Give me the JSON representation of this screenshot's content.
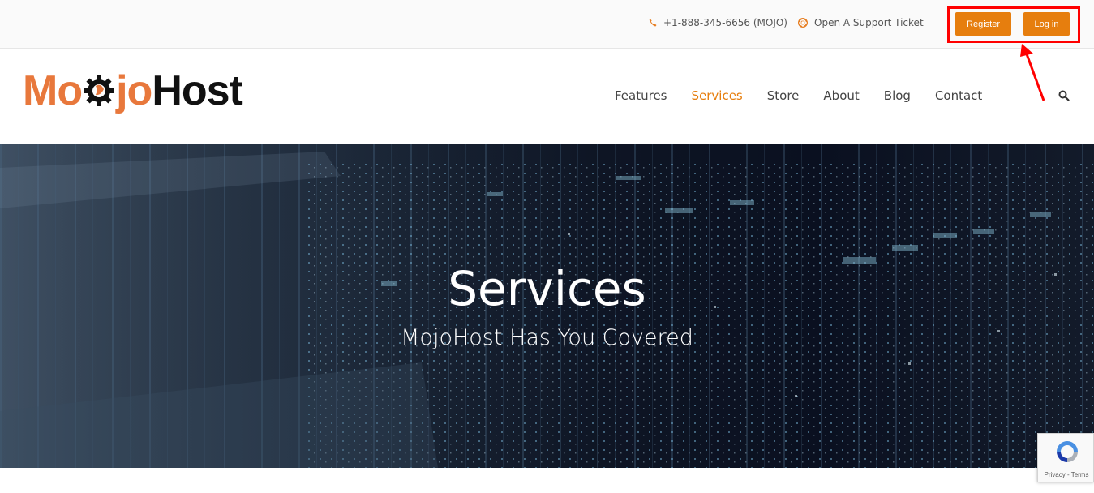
{
  "topbar": {
    "phone": "+1-888-345-6656 (MOJO)",
    "phone_icon": "phone-icon",
    "ticket": "Open A Support Ticket",
    "ticket_icon": "lifebuoy-icon",
    "register_label": "Register",
    "login_label": "Log in"
  },
  "brand": {
    "logo_left": "Mo",
    "logo_mid": "jo",
    "logo_right": "Host",
    "accent": "#e8783c"
  },
  "nav": {
    "items": [
      {
        "label": "Features",
        "active": false
      },
      {
        "label": "Services",
        "active": true
      },
      {
        "label": "Store",
        "active": false
      },
      {
        "label": "About",
        "active": false
      },
      {
        "label": "Blog",
        "active": false
      },
      {
        "label": "Contact",
        "active": false
      }
    ],
    "search_icon": "search-icon",
    "active_color": "#e67e0e"
  },
  "hero": {
    "title": "Services",
    "subtitle": "MojoHost Has You Covered"
  },
  "recaptcha": {
    "links": "Privacy - Terms"
  },
  "colors": {
    "button": "#e67e0e",
    "annotation": "#ff0000"
  }
}
